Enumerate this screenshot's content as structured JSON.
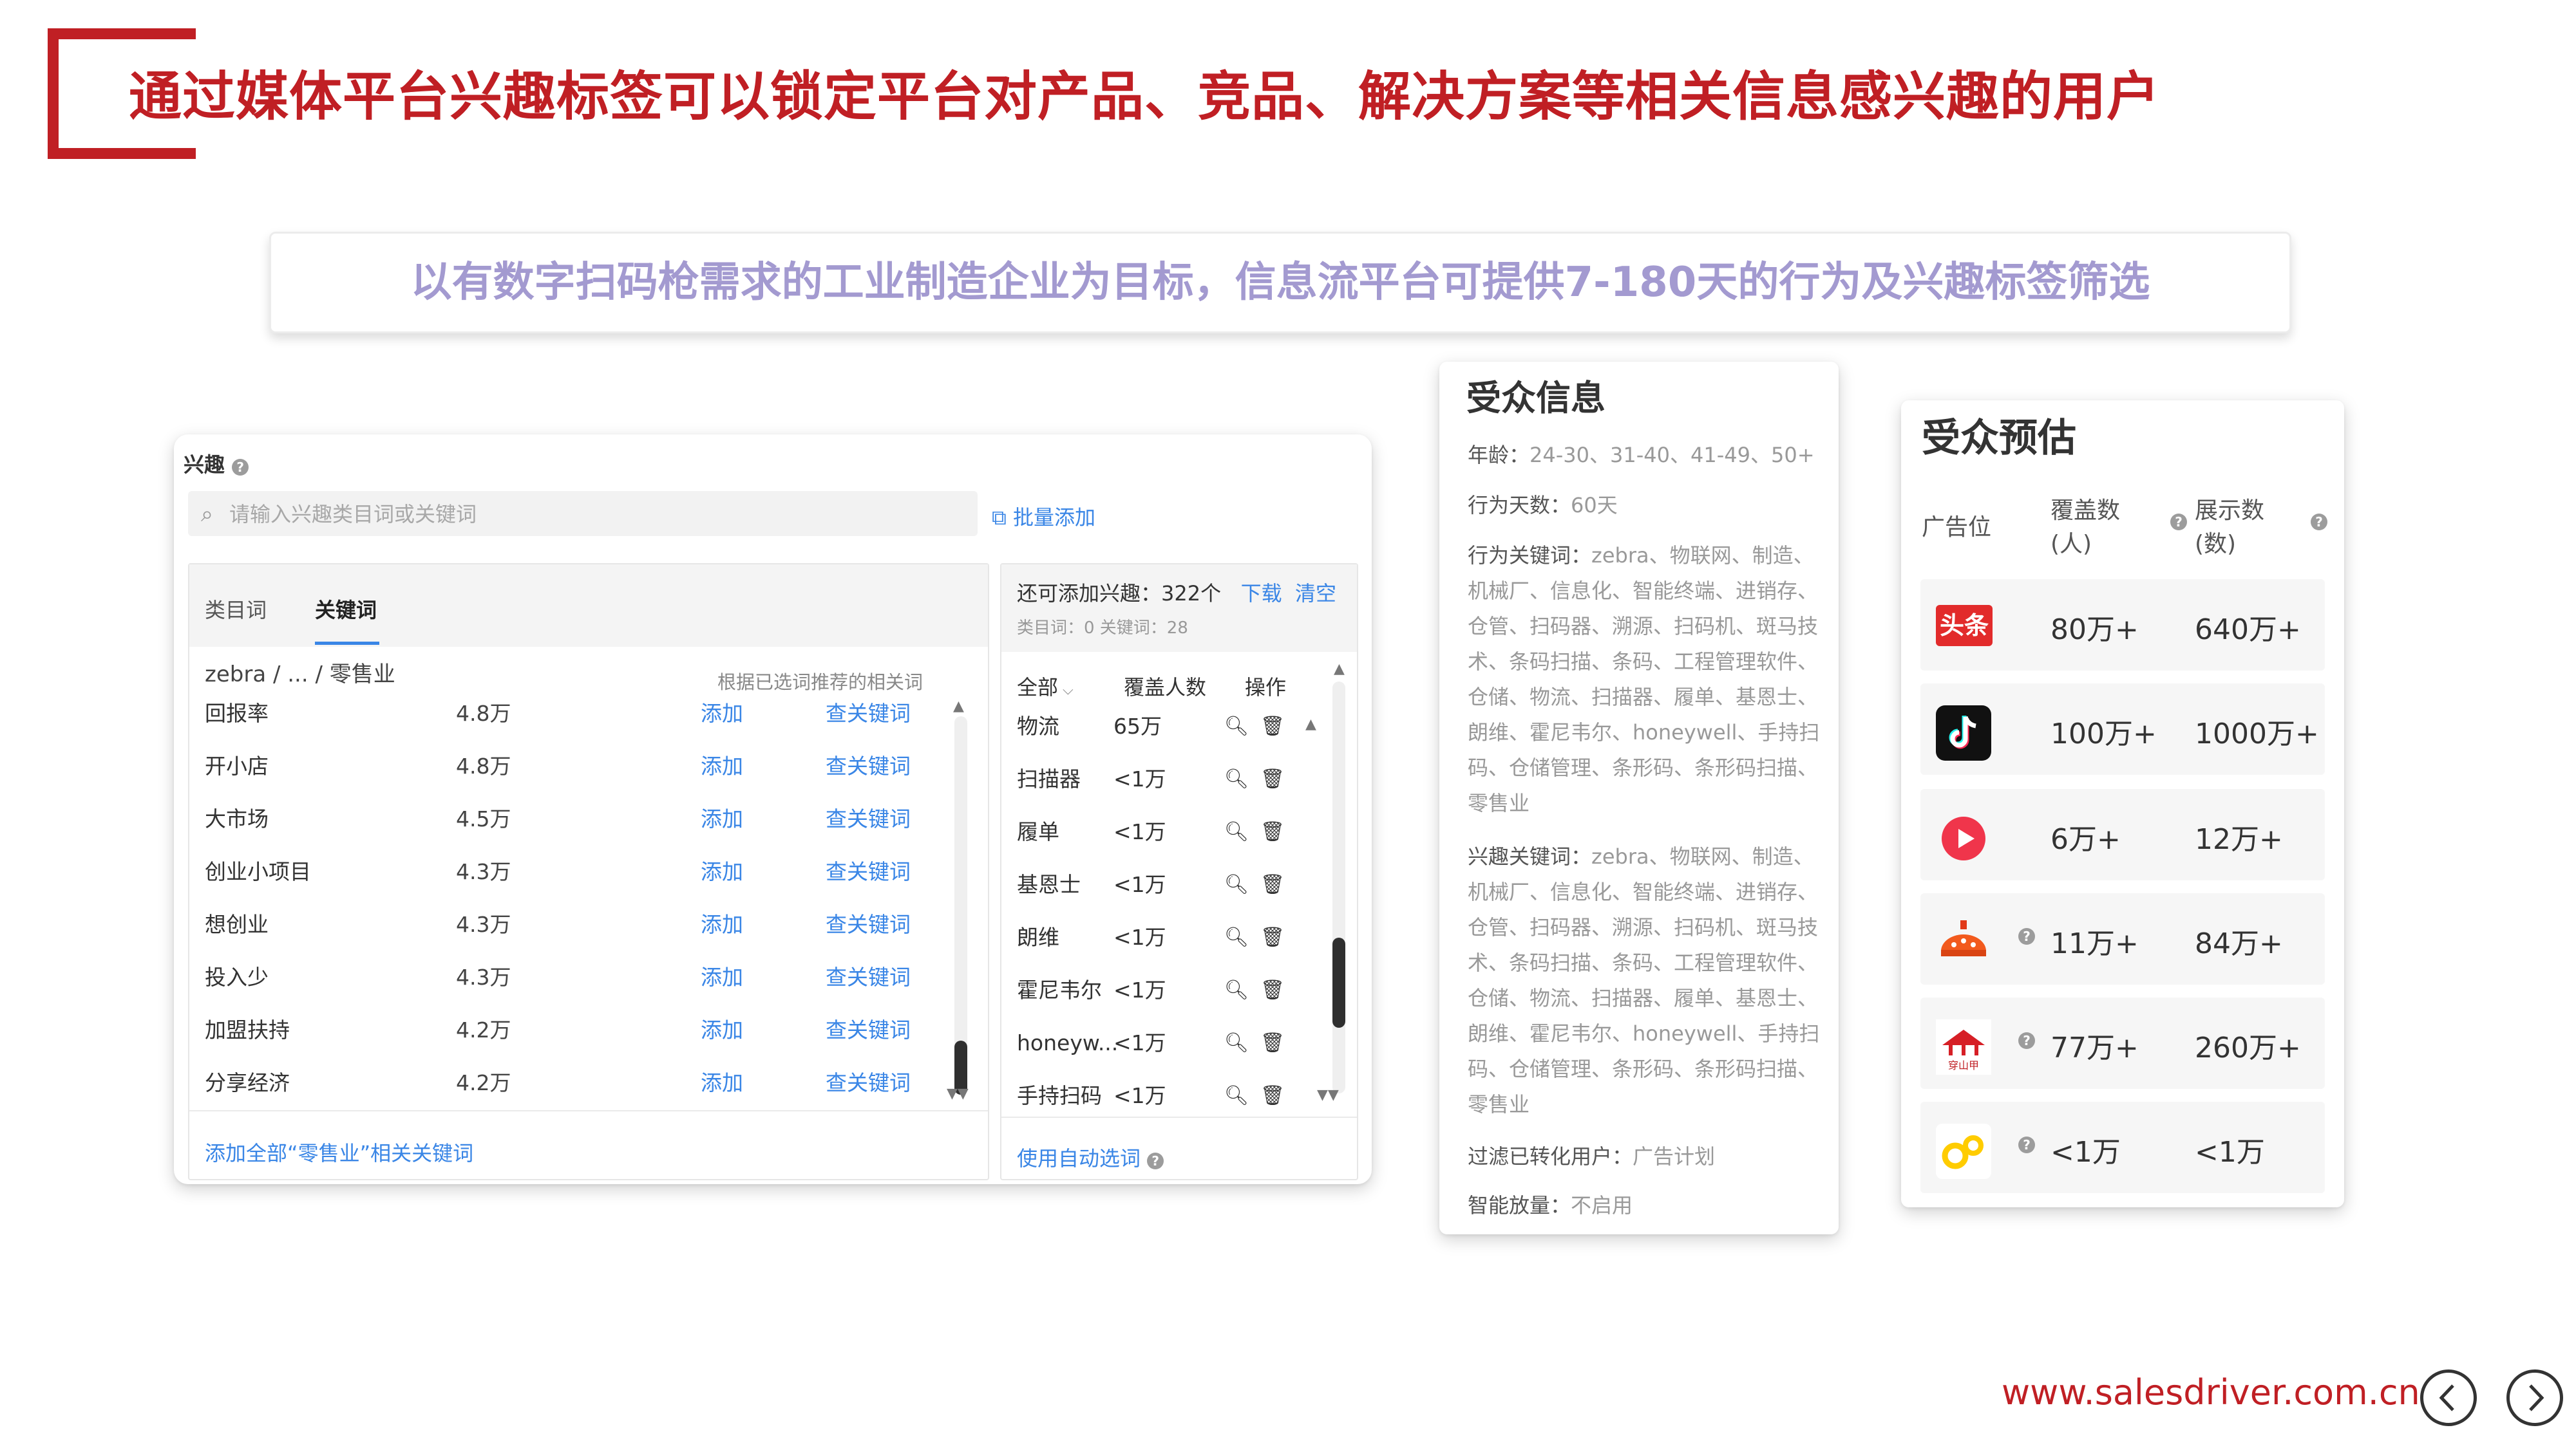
{
  "slide": {
    "title": "通过媒体平台兴趣标签可以锁定平台对产品、竞品、解决方案等相关信息感兴趣的用户",
    "subtitle": "以有数字扫码枪需求的工业制造企业为目标，信息流平台可提供7-180天的行为及兴趣标签筛选",
    "website": "www.salesdriver.com.cn",
    "accent_color": "#c01f24",
    "subtitle_color": "#a39ad0"
  },
  "interest": {
    "label": "兴趣",
    "search_placeholder": "请输入兴趣类目词或关键词",
    "batch_add": "批量添加",
    "tabs": [
      "类目词",
      "关键词"
    ],
    "active_tab": "关键词",
    "breadcrumb": "zebra / ... / 零售业",
    "hint": "根据已选词推荐的相关词",
    "add_label": "添加",
    "view_label": "查关键词",
    "keywords": [
      {
        "name": "回报率",
        "count": "4.8万"
      },
      {
        "name": "开小店",
        "count": "4.8万"
      },
      {
        "name": "大市场",
        "count": "4.5万"
      },
      {
        "name": "创业小项目",
        "count": "4.3万"
      },
      {
        "name": "想创业",
        "count": "4.3万"
      },
      {
        "name": "投入少",
        "count": "4.3万"
      },
      {
        "name": "加盟扶持",
        "count": "4.2万"
      },
      {
        "name": "分享经济",
        "count": "4.2万"
      }
    ],
    "add_all": "添加全部“零售业”相关关键词",
    "selected": {
      "remaining_label": "还可添加兴趣：322个",
      "download": "下载",
      "clear": "清空",
      "counts_line": "类目词：0    关键词：28",
      "col_all": "全部",
      "col_coverage": "覆盖人数",
      "col_action": "操作",
      "items": [
        {
          "name": "物流",
          "coverage": "65万"
        },
        {
          "name": "扫描器",
          "coverage": "<1万"
        },
        {
          "name": "履单",
          "coverage": "<1万"
        },
        {
          "name": "基恩士",
          "coverage": "<1万"
        },
        {
          "name": "朗维",
          "coverage": "<1万"
        },
        {
          "name": "霍尼韦尔",
          "coverage": "<1万"
        },
        {
          "name": "honeyw...",
          "coverage": "<1万"
        },
        {
          "name": "手持扫码",
          "coverage": "<1万"
        }
      ],
      "auto_pick": "使用自动选词"
    }
  },
  "audience_info": {
    "title": "受众信息",
    "lines": [
      {
        "label": "年龄：",
        "value": "24-30、31-40、41-49、50+"
      },
      {
        "label": "行为天数：",
        "value": "60天"
      },
      {
        "label": "行为关键词：",
        "value": "zebra、物联网、制造、机械厂、信息化、智能终端、进销存、仓管、扫码器、溯源、扫码机、斑马技术、条码扫描、条码、工程管理软件、仓储、物流、扫描器、履单、基恩士、朗维、霍尼韦尔、honeywell、手持扫码、仓储管理、条形码、条形码扫描、零售业"
      },
      {
        "label": "兴趣关键词：",
        "value": "zebra、物联网、制造、机械厂、信息化、智能终端、进销存、仓管、扫码器、溯源、扫码机、斑马技术、条码扫描、条码、工程管理软件、仓储、物流、扫描器、履单、基恩士、朗维、霍尼韦尔、honeywell、手持扫码、仓储管理、条形码、条形码扫描、零售业"
      },
      {
        "label": "过滤已转化用户：",
        "value": "广告计划"
      },
      {
        "label": "智能放量：",
        "value": "不启用"
      }
    ]
  },
  "audience_estimate": {
    "title": "受众预估",
    "col_placement": "广告位",
    "col_coverage": "覆盖数\n(人)",
    "col_impressions": "展示数\n(数)",
    "rows": [
      {
        "platform": "toutiao-logo",
        "logo_text": "头条",
        "coverage": "80万+",
        "impressions": "640万+",
        "has_help": false
      },
      {
        "platform": "douyin-logo",
        "logo_text": "",
        "coverage": "100万+",
        "impressions": "1000万+",
        "has_help": false
      },
      {
        "platform": "xigua-video-logo",
        "logo_text": "",
        "coverage": "6万+",
        "impressions": "12万+",
        "has_help": false
      },
      {
        "platform": "huoshan-logo",
        "logo_text": "",
        "coverage": "11万+",
        "impressions": "84万+",
        "has_help": true
      },
      {
        "platform": "chuanshanjia-logo",
        "logo_text": "穿山甲",
        "coverage": "77万+",
        "impressions": "260万+",
        "has_help": true
      },
      {
        "platform": "other-app-logo",
        "logo_text": "",
        "coverage": "<1万",
        "impressions": "<1万",
        "has_help": true
      }
    ]
  }
}
